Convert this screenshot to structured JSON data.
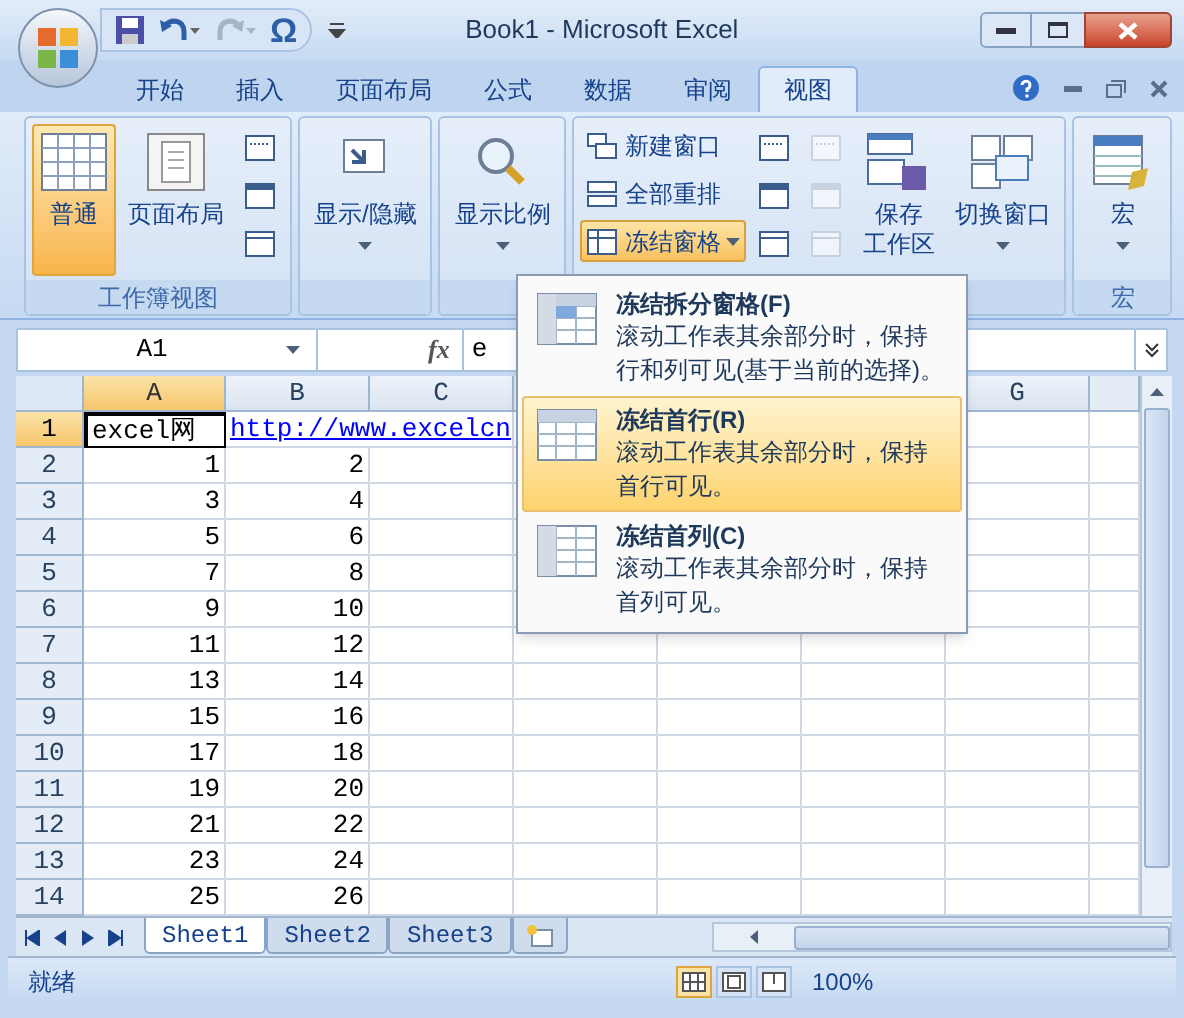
{
  "window": {
    "title": "Book1 - Microsoft Excel"
  },
  "quick_access": {
    "symbol": "Ω"
  },
  "tabs": [
    {
      "label": "开始",
      "selected": false
    },
    {
      "label": "插入",
      "selected": false
    },
    {
      "label": "页面布局",
      "selected": false
    },
    {
      "label": "公式",
      "selected": false
    },
    {
      "label": "数据",
      "selected": false
    },
    {
      "label": "审阅",
      "selected": false
    },
    {
      "label": "视图",
      "selected": true
    }
  ],
  "ribbon": {
    "groups": [
      {
        "label": "工作簿视图",
        "items": [
          {
            "kind": "large",
            "label": "普通",
            "selected": true
          },
          {
            "kind": "large",
            "label": "页面布局",
            "selected": false
          },
          {
            "kind": "icons",
            "disabled": false
          }
        ]
      },
      {
        "items": [
          {
            "kind": "large",
            "label": "显示/隐藏",
            "caret": true
          }
        ]
      },
      {
        "items": [
          {
            "kind": "large",
            "label": "显示比例",
            "caret": true
          }
        ]
      },
      {
        "items": [
          {
            "kind": "stack",
            "entries": [
              {
                "label": "新建窗口",
                "expanded": false
              },
              {
                "label": "全部重排",
                "expanded": false
              },
              {
                "label": "冻结窗格",
                "expanded": true
              }
            ]
          },
          {
            "kind": "icons",
            "disabled": false
          },
          {
            "kind": "icons",
            "disabled": true
          },
          {
            "kind": "large",
            "label_lines": [
              "保存",
              "工作区"
            ]
          },
          {
            "kind": "large",
            "label": "切换窗口",
            "caret": true
          }
        ]
      },
      {
        "label": "宏",
        "items": [
          {
            "kind": "large",
            "label": "宏",
            "caret": true
          }
        ]
      }
    ]
  },
  "formula_bar": {
    "name_box": "A1",
    "fx": "fx",
    "value": "e"
  },
  "freeze_menu": {
    "items": [
      {
        "title": "冻结拆分窗格(F)",
        "description": "滚动工作表其余部分时，保持行和列可见(基于当前的选择)。",
        "selected": false
      },
      {
        "title": "冻结首行(R)",
        "description": "滚动工作表其余部分时，保持首行可见。",
        "selected": true
      },
      {
        "title": "冻结首列(C)",
        "description": "滚动工作表其余部分时，保持首列可见。",
        "selected": false
      }
    ]
  },
  "grid": {
    "columns": [
      {
        "label": "A",
        "selected": true
      },
      {
        "label": "B",
        "selected": false
      },
      {
        "label": "C",
        "selected": false
      },
      {
        "label": "G",
        "selected": false
      }
    ],
    "rows": [
      {
        "number": "1",
        "selected": true,
        "cells": [
          {
            "kind": "text",
            "text": "excel网"
          },
          {
            "kind": "link",
            "text": "http://www.excelcn"
          }
        ]
      },
      {
        "number": "2",
        "selected": false,
        "cells": [
          {
            "kind": "number",
            "text": "1"
          },
          {
            "kind": "number",
            "text": "2"
          }
        ]
      },
      {
        "number": "3",
        "selected": false,
        "cells": [
          {
            "kind": "number",
            "text": "3"
          },
          {
            "kind": "number",
            "text": "4"
          }
        ]
      },
      {
        "number": "4",
        "selected": false,
        "cells": [
          {
            "kind": "number",
            "text": "5"
          },
          {
            "kind": "number",
            "text": "6"
          }
        ]
      },
      {
        "number": "5",
        "selected": false,
        "cells": [
          {
            "kind": "number",
            "text": "7"
          },
          {
            "kind": "number",
            "text": "8"
          }
        ]
      },
      {
        "number": "6",
        "selected": false,
        "cells": [
          {
            "kind": "number",
            "text": "9"
          },
          {
            "kind": "number",
            "text": "10"
          }
        ]
      },
      {
        "number": "7",
        "selected": false,
        "cells": [
          {
            "kind": "number",
            "text": "11"
          },
          {
            "kind": "number",
            "text": "12"
          }
        ]
      },
      {
        "number": "8",
        "selected": false,
        "cells": [
          {
            "kind": "number",
            "text": "13"
          },
          {
            "kind": "number",
            "text": "14"
          }
        ]
      },
      {
        "number": "9",
        "selected": false,
        "cells": [
          {
            "kind": "number",
            "text": "15"
          },
          {
            "kind": "number",
            "text": "16"
          }
        ]
      },
      {
        "number": "10",
        "selected": false,
        "cells": [
          {
            "kind": "number",
            "text": "17"
          },
          {
            "kind": "number",
            "text": "18"
          }
        ]
      },
      {
        "number": "11",
        "selected": false,
        "cells": [
          {
            "kind": "number",
            "text": "19"
          },
          {
            "kind": "number",
            "text": "20"
          }
        ]
      },
      {
        "number": "12",
        "selected": false,
        "cells": [
          {
            "kind": "number",
            "text": "21"
          },
          {
            "kind": "number",
            "text": "22"
          }
        ]
      },
      {
        "number": "13",
        "selected": false,
        "cells": [
          {
            "kind": "number",
            "text": "23"
          },
          {
            "kind": "number",
            "text": "24"
          }
        ]
      },
      {
        "number": "14",
        "selected": false,
        "cells": [
          {
            "kind": "number",
            "text": "25"
          },
          {
            "kind": "number",
            "text": "26"
          }
        ]
      }
    ]
  },
  "sheet_tabs": [
    {
      "label": "Sheet1",
      "selected": true
    },
    {
      "label": "Sheet2",
      "selected": false
    },
    {
      "label": "Sheet3",
      "selected": false
    }
  ],
  "status_bar": {
    "status": "就绪",
    "zoom": "100%",
    "views": [
      {
        "selected": true
      },
      {
        "selected": false
      },
      {
        "selected": false
      }
    ]
  }
}
